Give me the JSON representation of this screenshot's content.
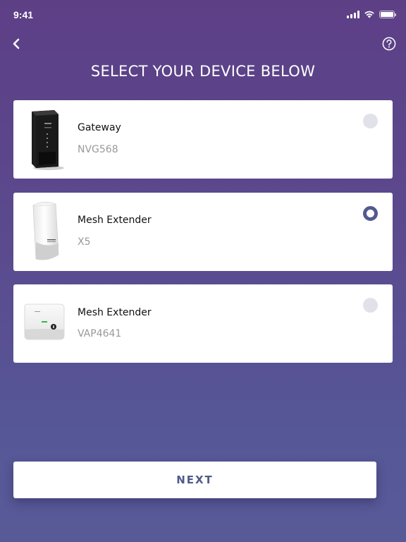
{
  "status_bar": {
    "time": "9:41"
  },
  "header": {
    "back_icon": "chevron-left-icon",
    "help_icon": "question-circle-icon",
    "title": "SELECT YOUR DEVICE BELOW"
  },
  "devices": [
    {
      "name": "Gateway",
      "model": "NVG568",
      "selected": false,
      "image": "gateway-image"
    },
    {
      "name": "Mesh Extender",
      "model": "X5",
      "selected": true,
      "image": "mesh-extender-tower-image"
    },
    {
      "name": "Mesh Extender",
      "model": "VAP4641",
      "selected": false,
      "image": "mesh-extender-wall-image"
    }
  ],
  "footer": {
    "next_label": "NEXT"
  },
  "colors": {
    "accent": "#525a8f",
    "background_top": "#5d3f86",
    "background_bottom": "#585a98"
  }
}
